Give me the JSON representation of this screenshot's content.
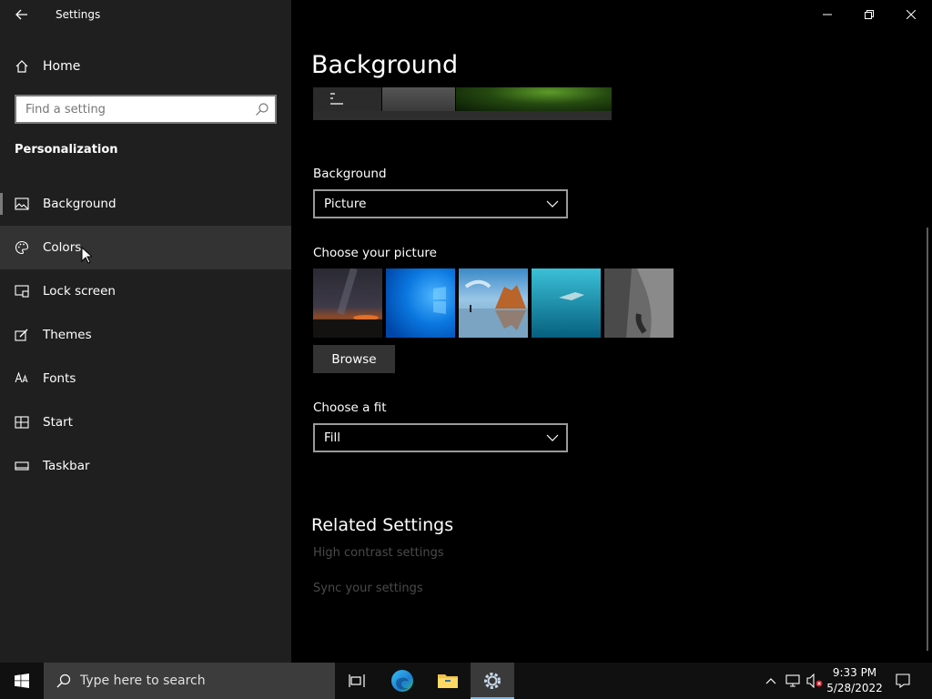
{
  "window": {
    "title": "Settings"
  },
  "sidebar": {
    "home_label": "Home",
    "search_placeholder": "Find a setting",
    "section_title": "Personalization",
    "items": [
      {
        "label": "Background"
      },
      {
        "label": "Colors"
      },
      {
        "label": "Lock screen"
      },
      {
        "label": "Themes"
      },
      {
        "label": "Fonts"
      },
      {
        "label": "Start"
      },
      {
        "label": "Taskbar"
      }
    ]
  },
  "main": {
    "page_title": "Background",
    "background_label": "Background",
    "background_value": "Picture",
    "choose_picture_label": "Choose your picture",
    "browse_label": "Browse",
    "fit_label": "Choose a fit",
    "fit_value": "Fill",
    "related_title": "Related Settings",
    "related_links": [
      {
        "label": "High contrast settings"
      },
      {
        "label": "Sync your settings"
      }
    ]
  },
  "taskbar": {
    "search_placeholder": "Type here to search",
    "time": "9:33 PM",
    "date": "5/28/2022"
  },
  "colors": {
    "sidebar_bg": "#1f1f1f",
    "main_bg": "#000000",
    "accent": "#76b9ed"
  }
}
